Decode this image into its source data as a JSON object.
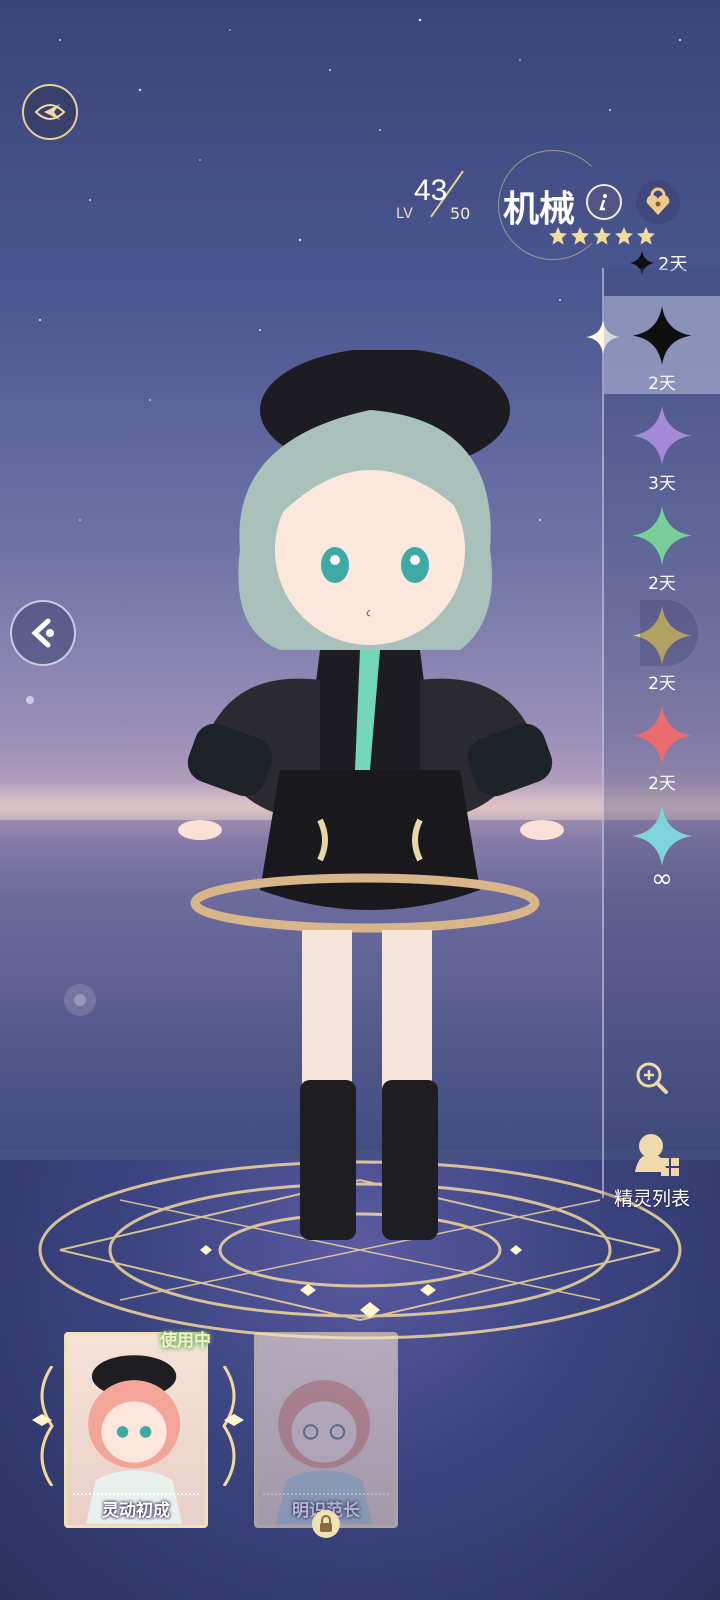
{
  "level": {
    "label": "LV",
    "current": "43",
    "max": "50"
  },
  "pet": {
    "name": "机械",
    "star_count": 5
  },
  "top_timer": "2天",
  "swatches": [
    {
      "color": "#0f0f12",
      "days": "2天",
      "selected": true
    },
    {
      "color": "#a48ad8",
      "days": "3天",
      "selected": false
    },
    {
      "color": "#79cf98",
      "days": "2天",
      "selected": false
    },
    {
      "color": "#f3d55e",
      "days": "2天",
      "selected": false
    },
    {
      "color": "#ec6b6f",
      "days": "2天",
      "selected": false
    },
    {
      "color": "#7fd4dc",
      "days": "∞",
      "selected": false
    }
  ],
  "side_buttons": {
    "sprite_list": "精灵列表"
  },
  "cards": [
    {
      "name": "灵动初成",
      "status": "使用中",
      "locked": false
    },
    {
      "name": "明识范长",
      "locked": true
    }
  ],
  "icons": {
    "logo": "feather-emblem-icon",
    "info": "info-icon",
    "lock": "heart-lock-icon",
    "back": "chevron-left-icon",
    "zoom": "zoom-in-icon",
    "sprite_list": "sprite-list-icon"
  }
}
